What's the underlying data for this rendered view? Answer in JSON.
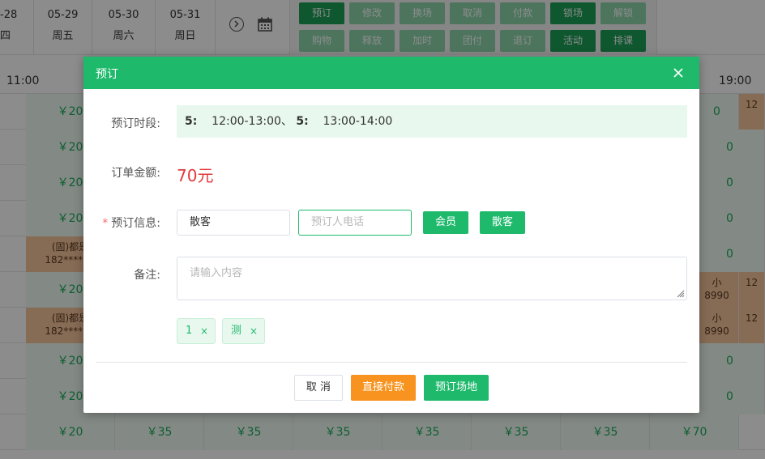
{
  "top_dates": [
    {
      "date": "-28",
      "weekday": "四"
    },
    {
      "date": "05-29",
      "weekday": "周五"
    },
    {
      "date": "05-30",
      "weekday": "周六"
    },
    {
      "date": "05-31",
      "weekday": "周日"
    }
  ],
  "action_buttons_row1": [
    "预订",
    "修改",
    "换场",
    "取消",
    "付款",
    "锁场",
    "解锁"
  ],
  "action_buttons_row2": [
    "购物",
    "释放",
    "加时",
    "团付",
    "退订",
    "活动",
    "排课"
  ],
  "time_header": {
    "left": "11:00",
    "right": "19:00"
  },
  "grid": {
    "col1_price": "￥20",
    "booked_name": "(固)都是",
    "booked_phone": "182****86",
    "right_price": "0",
    "right_booked_name": "小",
    "right_booked_phone": "8990",
    "edge_booked": "12",
    "bottom_row": [
      "￥20",
      "￥35",
      "￥35",
      "￥35",
      "￥35",
      "￥35",
      "￥35",
      "￥70"
    ]
  },
  "modal": {
    "title": "预订",
    "time_label": "预订时段:",
    "time_text_a_num": "5:",
    "time_text_a": "12:00-13:00、",
    "time_text_b_num": "5:",
    "time_text_b": "13:00-14:00",
    "amount_label": "订单金额:",
    "amount": "70元",
    "info_label": "预订信息:",
    "name_value": "散客",
    "phone_placeholder": "预订人电话",
    "member_button": "会员",
    "guest_button": "散客",
    "remark_label": "备注:",
    "remark_placeholder": "请输入内容",
    "tags": [
      "1",
      "测"
    ],
    "tag_close": "×",
    "cancel_button": "取 消",
    "pay_button": "直接付款",
    "book_button": "预订场地"
  }
}
